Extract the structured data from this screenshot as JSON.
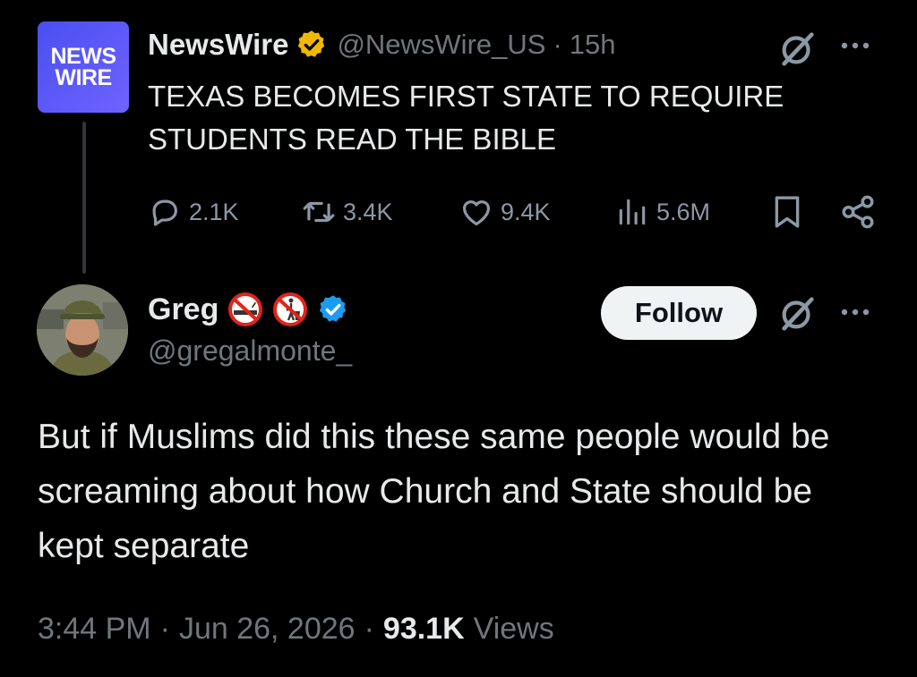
{
  "parent_tweet": {
    "logo_lines": [
      "NEWS",
      "WIRE"
    ],
    "author_name": "NewsWire",
    "handle": "@NewsWire_US",
    "separator": "·",
    "time": "15h",
    "text": "TEXAS BECOMES FIRST STATE TO REQUIRE STUDENTS READ THE BIBLE",
    "stats": {
      "replies": "2.1K",
      "reposts": "3.4K",
      "likes": "9.4K",
      "views": "5.6M"
    },
    "badge_color": "#f2b705",
    "logo_color": "#5a55f5",
    "icons": [
      "reply-icon",
      "repost-icon",
      "like-icon",
      "views-icon",
      "bookmark-icon",
      "share-icon",
      "grok-icon",
      "more-icon"
    ]
  },
  "reply": {
    "author_name": "Greg",
    "handle": "@gregalmonte_",
    "follow_label": "Follow",
    "text": "But if Muslims did this these same people would be screaming about how Church and State should be kept separate",
    "timestamp": "3:44 PM",
    "separator": "·",
    "date": "Jun 26, 2026",
    "views_count": "93.1K",
    "views_label": "Views",
    "badge_color": "#1d9bf0",
    "icons": [
      "no-smoking-emoji-icon",
      "no-littering-emoji-icon",
      "verified-badge-icon",
      "grok-icon",
      "more-icon"
    ]
  }
}
